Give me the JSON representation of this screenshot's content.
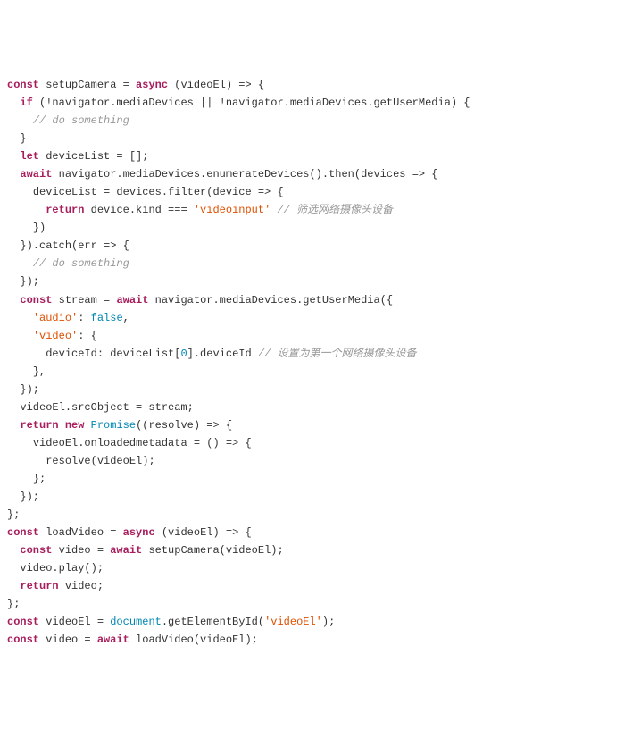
{
  "code": {
    "lines": [
      {
        "indent": 0,
        "tokens": [
          {
            "t": "kw",
            "v": "const"
          },
          {
            "t": "p",
            "v": " setupCamera = "
          },
          {
            "t": "kw",
            "v": "async"
          },
          {
            "t": "p",
            "v": " (videoEl) => {"
          }
        ]
      },
      {
        "indent": 1,
        "tokens": [
          {
            "t": "kw",
            "v": "if"
          },
          {
            "t": "p",
            "v": " (!navigator.mediaDevices || !navigator.mediaDevices.getUserMedia) {"
          }
        ]
      },
      {
        "indent": 2,
        "tokens": [
          {
            "t": "com",
            "v": "// do something"
          }
        ]
      },
      {
        "indent": 1,
        "tokens": [
          {
            "t": "p",
            "v": "}"
          }
        ]
      },
      {
        "indent": 0,
        "tokens": [
          {
            "t": "p",
            "v": ""
          }
        ]
      },
      {
        "indent": 1,
        "tokens": [
          {
            "t": "kw",
            "v": "let"
          },
          {
            "t": "p",
            "v": " deviceList = [];"
          }
        ]
      },
      {
        "indent": 1,
        "tokens": [
          {
            "t": "kw",
            "v": "await"
          },
          {
            "t": "p",
            "v": " navigator.mediaDevices.enumerateDevices().then(devices => {"
          }
        ]
      },
      {
        "indent": 2,
        "tokens": [
          {
            "t": "p",
            "v": "deviceList = devices.filter(device => {"
          }
        ]
      },
      {
        "indent": 3,
        "tokens": [
          {
            "t": "kw",
            "v": "return"
          },
          {
            "t": "p",
            "v": " device.kind === "
          },
          {
            "t": "str",
            "v": "'videoinput'"
          },
          {
            "t": "p",
            "v": " "
          },
          {
            "t": "com",
            "v": "// 筛选网络摄像头设备"
          }
        ]
      },
      {
        "indent": 2,
        "tokens": [
          {
            "t": "p",
            "v": "})"
          }
        ]
      },
      {
        "indent": 1,
        "tokens": [
          {
            "t": "p",
            "v": "}).catch(err => {"
          }
        ]
      },
      {
        "indent": 2,
        "tokens": [
          {
            "t": "com",
            "v": "// do something"
          }
        ]
      },
      {
        "indent": 1,
        "tokens": [
          {
            "t": "p",
            "v": "});"
          }
        ]
      },
      {
        "indent": 0,
        "tokens": [
          {
            "t": "p",
            "v": ""
          }
        ]
      },
      {
        "indent": 1,
        "tokens": [
          {
            "t": "kw",
            "v": "const"
          },
          {
            "t": "p",
            "v": " stream = "
          },
          {
            "t": "kw",
            "v": "await"
          },
          {
            "t": "p",
            "v": " navigator.mediaDevices.getUserMedia({"
          }
        ]
      },
      {
        "indent": 2,
        "tokens": [
          {
            "t": "str",
            "v": "'audio'"
          },
          {
            "t": "p",
            "v": ": "
          },
          {
            "t": "bool",
            "v": "false"
          },
          {
            "t": "p",
            "v": ","
          }
        ]
      },
      {
        "indent": 2,
        "tokens": [
          {
            "t": "str",
            "v": "'video'"
          },
          {
            "t": "p",
            "v": ": {"
          }
        ]
      },
      {
        "indent": 3,
        "tokens": [
          {
            "t": "p",
            "v": "deviceId: deviceList["
          },
          {
            "t": "num",
            "v": "0"
          },
          {
            "t": "p",
            "v": "].deviceId "
          },
          {
            "t": "com",
            "v": "// 设置为第一个网络摄像头设备"
          }
        ]
      },
      {
        "indent": 2,
        "tokens": [
          {
            "t": "p",
            "v": "},"
          }
        ]
      },
      {
        "indent": 1,
        "tokens": [
          {
            "t": "p",
            "v": "});"
          }
        ]
      },
      {
        "indent": 1,
        "tokens": [
          {
            "t": "p",
            "v": "videoEl.srcObject = stream;"
          }
        ]
      },
      {
        "indent": 0,
        "tokens": [
          {
            "t": "p",
            "v": ""
          }
        ]
      },
      {
        "indent": 1,
        "tokens": [
          {
            "t": "kw",
            "v": "return"
          },
          {
            "t": "p",
            "v": " "
          },
          {
            "t": "kw",
            "v": "new"
          },
          {
            "t": "p",
            "v": " "
          },
          {
            "t": "obj",
            "v": "Promise"
          },
          {
            "t": "p",
            "v": "((resolve) => {"
          }
        ]
      },
      {
        "indent": 2,
        "tokens": [
          {
            "t": "p",
            "v": "videoEl.onloadedmetadata = () => {"
          }
        ]
      },
      {
        "indent": 3,
        "tokens": [
          {
            "t": "p",
            "v": "resolve(videoEl);"
          }
        ]
      },
      {
        "indent": 2,
        "tokens": [
          {
            "t": "p",
            "v": "};"
          }
        ]
      },
      {
        "indent": 1,
        "tokens": [
          {
            "t": "p",
            "v": "});"
          }
        ]
      },
      {
        "indent": 0,
        "tokens": [
          {
            "t": "p",
            "v": "};"
          }
        ]
      },
      {
        "indent": 0,
        "tokens": [
          {
            "t": "p",
            "v": ""
          }
        ]
      },
      {
        "indent": 0,
        "tokens": [
          {
            "t": "kw",
            "v": "const"
          },
          {
            "t": "p",
            "v": " loadVideo = "
          },
          {
            "t": "kw",
            "v": "async"
          },
          {
            "t": "p",
            "v": " (videoEl) => {"
          }
        ]
      },
      {
        "indent": 1,
        "tokens": [
          {
            "t": "kw",
            "v": "const"
          },
          {
            "t": "p",
            "v": " video = "
          },
          {
            "t": "kw",
            "v": "await"
          },
          {
            "t": "p",
            "v": " setupCamera(videoEl);"
          }
        ]
      },
      {
        "indent": 1,
        "tokens": [
          {
            "t": "p",
            "v": "video.play();"
          }
        ]
      },
      {
        "indent": 1,
        "tokens": [
          {
            "t": "kw",
            "v": "return"
          },
          {
            "t": "p",
            "v": " video;"
          }
        ]
      },
      {
        "indent": 0,
        "tokens": [
          {
            "t": "p",
            "v": "};"
          }
        ]
      },
      {
        "indent": 0,
        "tokens": [
          {
            "t": "p",
            "v": ""
          }
        ]
      },
      {
        "indent": 0,
        "tokens": [
          {
            "t": "kw",
            "v": "const"
          },
          {
            "t": "p",
            "v": " videoEl = "
          },
          {
            "t": "obj",
            "v": "document"
          },
          {
            "t": "p",
            "v": ".getElementById("
          },
          {
            "t": "str",
            "v": "'videoEl'"
          },
          {
            "t": "p",
            "v": ");"
          }
        ]
      },
      {
        "indent": 0,
        "tokens": [
          {
            "t": "kw",
            "v": "const"
          },
          {
            "t": "p",
            "v": " video = "
          },
          {
            "t": "kw",
            "v": "await"
          },
          {
            "t": "p",
            "v": " loadVideo(videoEl);"
          }
        ]
      }
    ]
  }
}
